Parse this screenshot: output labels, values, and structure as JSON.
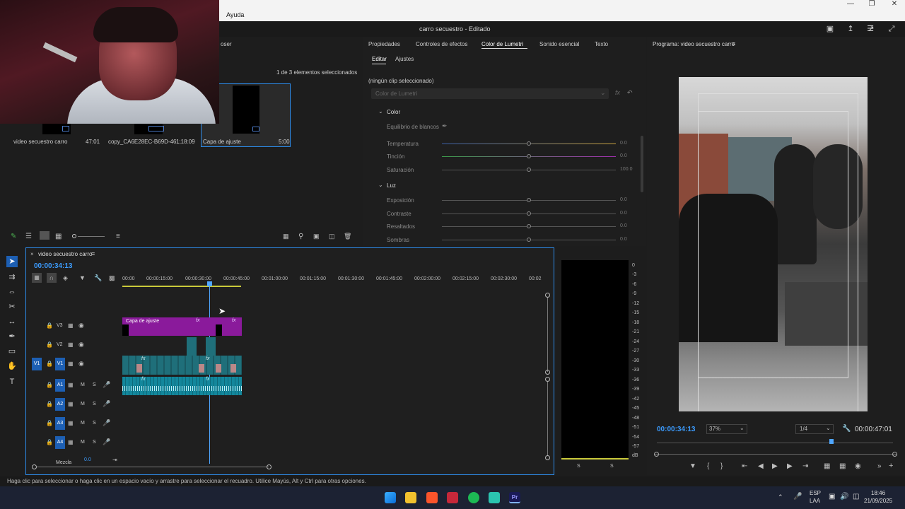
{
  "menu": {
    "help": "Ayuda"
  },
  "window": {
    "title": "carro secuestro - Editado"
  },
  "project": {
    "truncated_name": "oser",
    "selection_count": "1 de 3 elementos seleccionados",
    "items": [
      {
        "name": "video secuestro carro",
        "duration": "47:01"
      },
      {
        "name": "copy_CA6E28EC-B69D-46...",
        "duration": "1:18:09"
      },
      {
        "name": "Capa de ajuste",
        "duration": "5:00"
      }
    ]
  },
  "lumetri": {
    "tabs": [
      "Propiedades",
      "Controles de efectos",
      "Color de Lumetri",
      "Sonido esencial",
      "Texto"
    ],
    "subtabs": [
      "Editar",
      "Ajustes"
    ],
    "no_clip": "(ningún clip seleccionado)",
    "preset_placeholder": "Color de Lumetri",
    "sections": {
      "color": "Color",
      "white_balance": "Equilibrio de blancos",
      "light": "Luz"
    },
    "color_rows": [
      {
        "label": "Temperatura",
        "value": "0.0"
      },
      {
        "label": "Tinción",
        "value": "0.0"
      },
      {
        "label": "Saturación",
        "value": "100.0"
      }
    ],
    "light_rows": [
      {
        "label": "Exposición",
        "value": "0.0"
      },
      {
        "label": "Contraste",
        "value": "0.0"
      },
      {
        "label": "Resaltados",
        "value": "0.0"
      },
      {
        "label": "Sombras",
        "value": "0.0"
      }
    ]
  },
  "program": {
    "title": "Programa: video secuestro carro",
    "timecode": "00:00:34:13",
    "zoom": "37%",
    "resolution": "1/4",
    "duration": "00:00:47:01"
  },
  "timeline": {
    "sequence_name": "video secuestro carro",
    "timecode": "00:00:34:13",
    "ruler": [
      "00:00",
      "00:00:15:00",
      "00:00:30:00",
      "00:00:45:00",
      "00:01:00:00",
      "00:01:15:00",
      "00:01:30:00",
      "00:01:45:00",
      "00:02:00:00",
      "00:02:15:00",
      "00:02:30:00",
      "00:02"
    ],
    "video_tracks": [
      "V3",
      "V2",
      "V1"
    ],
    "audio_tracks": [
      "A1",
      "A2",
      "A3",
      "A4"
    ],
    "source_patch": "V1",
    "adjustment_clip": "Capa de ajuste",
    "mix_label": "Mezcla",
    "mix_value": "0.0",
    "m": "M",
    "s": "S",
    "fx": "fx"
  },
  "meter": {
    "scale": [
      "0",
      "-3",
      "-6",
      "-9",
      "-12",
      "-15",
      "-18",
      "-21",
      "-24",
      "-27",
      "-30",
      "-33",
      "-36",
      "-39",
      "-42",
      "-45",
      "-48",
      "-51",
      "-54",
      "-57",
      "dB"
    ],
    "solo_left": "S",
    "solo_right": "S"
  },
  "status": {
    "hint": "Haga clic para seleccionar o haga clic en un espacio vacío y arrastre para seleccionar el recuadro. Utilice Mayús, Alt y Ctrl para otras opciones."
  },
  "taskbar": {
    "lang1": "ESP",
    "lang2": "LAA",
    "time": "18:46",
    "date": "21/09/2025"
  },
  "colors": {
    "accent": "#2d8ceb",
    "adjustment_clip": "#8a1a9b",
    "video_clip": "#1f6f7a",
    "audio_clip": "#13879c",
    "playhead": "#4fa6ff",
    "timecode_blue": "#3c9cff"
  }
}
